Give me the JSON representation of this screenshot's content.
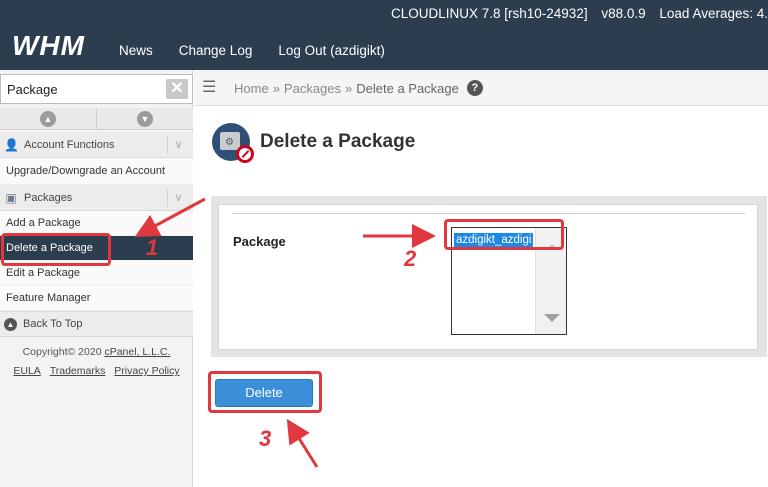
{
  "header": {
    "server": "CLOUDLINUX 7.8 [rsh10-24932]",
    "version": "v88.0.9",
    "load": "Load Averages: 4.",
    "logo": "WHM",
    "nav": [
      {
        "label": "News"
      },
      {
        "label": "Change Log"
      },
      {
        "label": "Log Out (azdigikt)"
      }
    ]
  },
  "sidebar": {
    "search_value": "Package",
    "clear_icon": "close-icon",
    "categories": [
      {
        "label": "Account Functions",
        "icon": "user-icon"
      },
      {
        "label": "Packages",
        "icon": "box-icon"
      }
    ],
    "account_items": [
      {
        "label": "Upgrade/Downgrade an Account"
      }
    ],
    "package_items": [
      {
        "label": "Add a Package"
      },
      {
        "label": "Delete a Package"
      },
      {
        "label": "Edit a Package"
      },
      {
        "label": "Feature Manager"
      }
    ],
    "back_to_top": "Back To Top",
    "copyright": "Copyright© 2020",
    "copyright_link": "cPanel, L.L.C.",
    "links": [
      "EULA",
      "Trademarks",
      "Privacy Policy"
    ]
  },
  "breadcrumb": {
    "home": "Home",
    "packages": "Packages",
    "current": "Delete a Package",
    "separator": "»",
    "help": "?"
  },
  "page": {
    "title": "Delete a Package",
    "package_label": "Package",
    "selected_package": "azdigikt_azdigi",
    "delete_label": "Delete"
  },
  "annotations": {
    "step1": "1",
    "step2": "2",
    "step3": "3",
    "color": "#e0383e"
  }
}
